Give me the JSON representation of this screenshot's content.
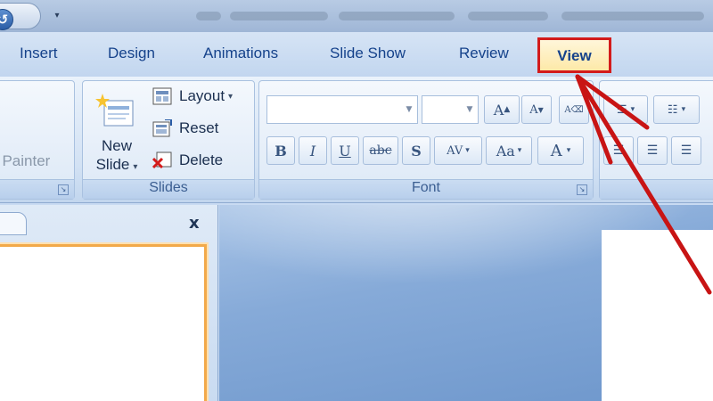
{
  "tabs": [
    "Insert",
    "Design",
    "Animations",
    "Slide Show",
    "Review",
    "View"
  ],
  "active_tab": "View",
  "quick_access": {
    "undo_icon": "undo-icon",
    "dropdown_icon": "qa-dropdown-icon"
  },
  "clipboard": {
    "format_painter_label": "t Painter"
  },
  "slides_group": {
    "label": "Slides",
    "new_slide_line1": "New",
    "new_slide_line2": "Slide",
    "layout_label": "Layout",
    "reset_label": "Reset",
    "delete_label": "Delete"
  },
  "font_group": {
    "label": "Font",
    "font_name": "",
    "font_size": "",
    "buttons": {
      "grow": "A",
      "shrink": "A",
      "bold": "B",
      "italic": "I",
      "underline": "U",
      "strike": "abc",
      "shadow": "S",
      "spacing": "AV",
      "case": "Aa",
      "color": "A"
    }
  },
  "panel": {
    "close_label": "x"
  },
  "colors": {
    "accent": "#15428b",
    "highlight": "#d31b1b",
    "selection": "#f2a94a"
  }
}
